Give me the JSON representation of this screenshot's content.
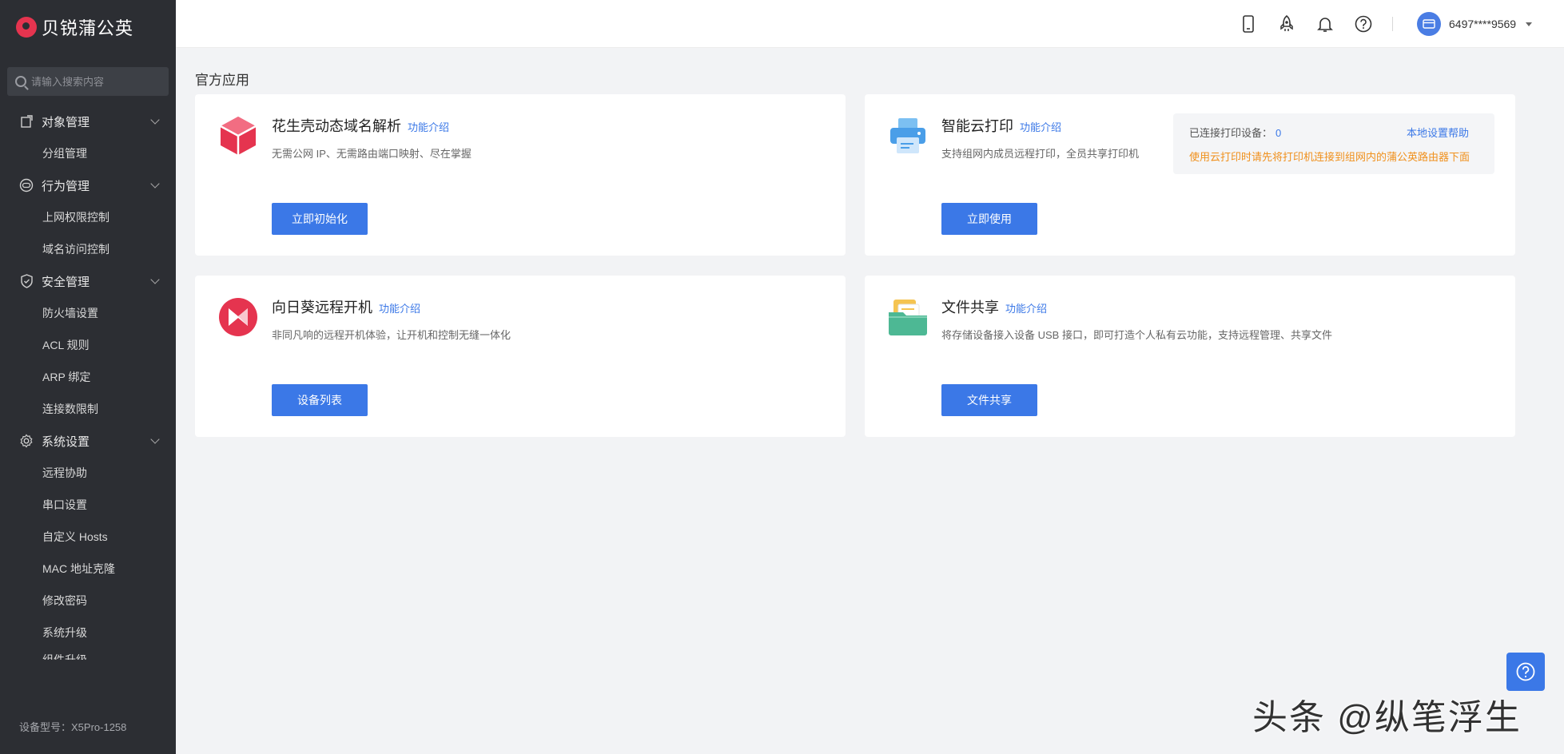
{
  "app": {
    "brand": "贝锐蒲公英"
  },
  "sidebar": {
    "search_placeholder": "请输入搜索内容",
    "groups": [
      {
        "label": "对象管理",
        "icon": "object-icon",
        "items": [
          "分组管理"
        ]
      },
      {
        "label": "行为管理",
        "icon": "behavior-icon",
        "items": [
          "上网权限控制",
          "域名访问控制"
        ]
      },
      {
        "label": "安全管理",
        "icon": "shield-icon",
        "items": [
          "防火墙设置",
          "ACL 规则",
          "ARP 绑定",
          "连接数限制"
        ]
      },
      {
        "label": "系统设置",
        "icon": "gear-icon",
        "items": [
          "远程协助",
          "串口设置",
          "自定义 Hosts",
          "MAC 地址克隆",
          "修改密码",
          "系统升级",
          "组件升级"
        ]
      }
    ],
    "model_label": "设备型号：X5Pro-1258"
  },
  "header": {
    "icons": [
      "mobile-icon",
      "rocket-icon",
      "bell-icon",
      "help-icon"
    ],
    "user_name": "6497****9569"
  },
  "main": {
    "section_title": "官方应用",
    "cards": [
      {
        "title": "花生壳动态域名解析",
        "link": "功能介绍",
        "desc": "无需公网 IP、无需路由端口映射、尽在掌握",
        "button": "立即初始化",
        "icon": "cube-icon",
        "color": "#e5344f"
      },
      {
        "title": "智能云打印",
        "link": "功能介绍",
        "desc": "支持组网内成员远程打印，全员共享打印机",
        "button": "立即使用",
        "icon": "printer-icon",
        "color": "#4a9ee8"
      },
      {
        "title": "向日葵远程开机",
        "link": "功能介绍",
        "desc": "非同凡响的远程开机体验，让开机和控制无缝一体化",
        "button": "设备列表",
        "icon": "power-on-icon",
        "color": "#e5344f"
      },
      {
        "title": "文件共享",
        "link": "功能介绍",
        "desc": "将存储设备接入设备 USB 接口，即可打造个人私有云功能，支持远程管理、共享文件",
        "button": "文件共享",
        "icon": "folder-icon",
        "color": "#4db894"
      }
    ],
    "print_panel": {
      "connected_label": "已连接打印设备：",
      "connected_count": "0",
      "help_link": "本地设置帮助",
      "warning": "使用云打印时请先将打印机连接到组网内的蒲公英路由器下面"
    }
  },
  "watermark": "头条 @纵笔浮生"
}
